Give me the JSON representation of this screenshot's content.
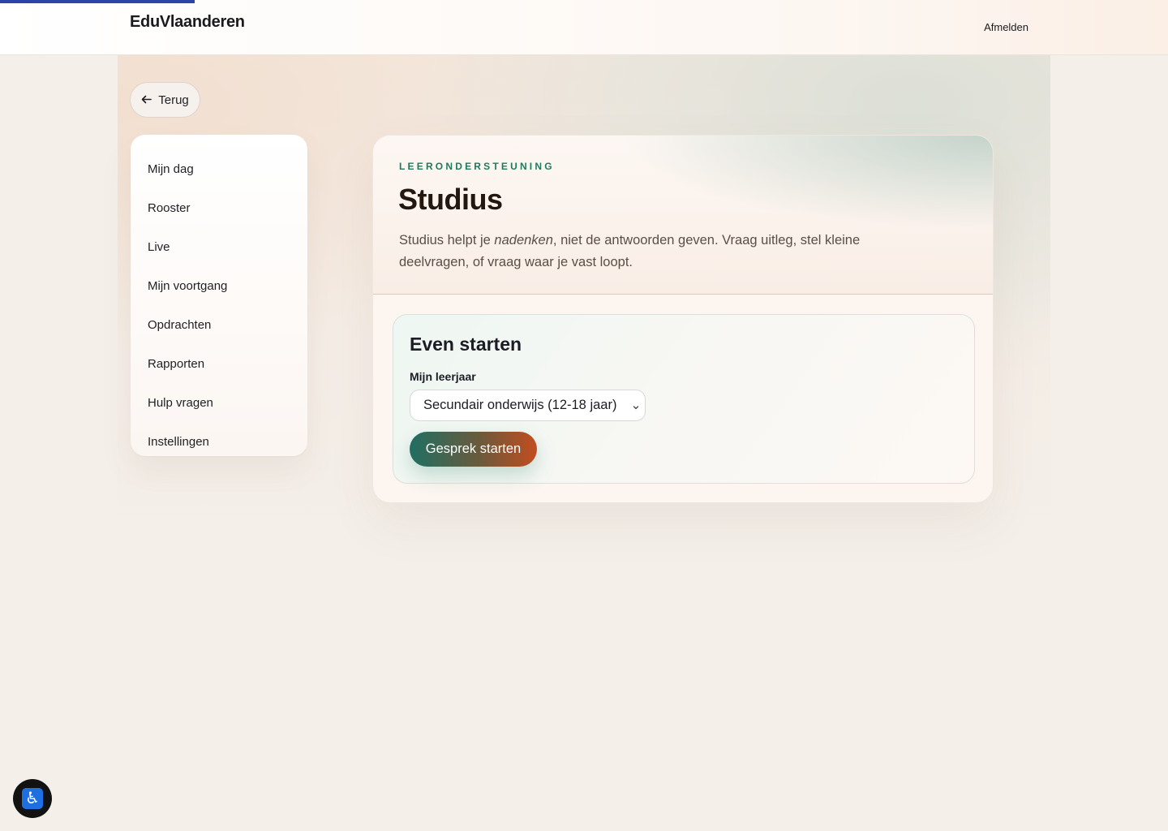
{
  "header": {
    "brand": "EduVlaanderen",
    "logout_label": "Afmelden"
  },
  "back_button": {
    "label": "Terug",
    "icon": "arrow-left-icon"
  },
  "sidebar": {
    "items": [
      {
        "label": "Mijn dag"
      },
      {
        "label": "Rooster"
      },
      {
        "label": "Live"
      },
      {
        "label": "Mijn voortgang"
      },
      {
        "label": "Opdrachten"
      },
      {
        "label": "Rapporten"
      },
      {
        "label": "Hulp vragen"
      },
      {
        "label": "Instellingen"
      }
    ]
  },
  "main": {
    "eyebrow": "LEERONDERSTEUNING",
    "title": "Studius",
    "description": {
      "before": "Studius helpt je ",
      "emphasis": "nadenken",
      "after": ", niet de antwoorden geven. Vraag uitleg, stel kleine deelvragen, of vraag waar je vast loopt."
    },
    "start": {
      "title": "Even starten",
      "grade_label": "Mijn leerjaar",
      "grade_selected": "Secundair onderwijs (12-18 jaar)",
      "button_label": "Gesprek starten"
    }
  },
  "accessibility": {
    "icon": "accessibility-icon",
    "glyph": "♿"
  },
  "colors": {
    "accent_blue": "#2b44a8",
    "eyebrow_green": "#1f7a60",
    "cta_start": "#1f6f62",
    "cta_end": "#c24d20"
  }
}
